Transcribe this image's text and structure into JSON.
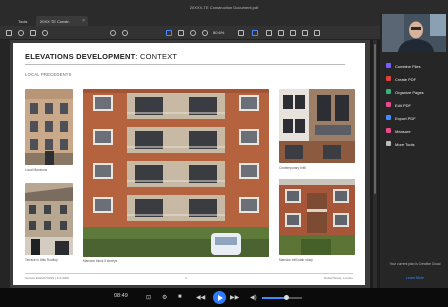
{
  "window": {
    "title": "20XXX-TE Construction Document.pdf"
  },
  "tabs": [
    {
      "label": "Tools"
    },
    {
      "label": "20XX TE Constr."
    }
  ],
  "toolbar": {
    "zoom": "80.6%"
  },
  "page": {
    "title_bold": "ELEVATIONS DEVELOPMENT",
    "title_rest": ": CONTEXT",
    "subtitle": "LOCAL PRECEDENTS",
    "captions": [
      "Local Mansions",
      "Terrace in Attic Rooftop",
      "Mansion block 5 storeys",
      "Contemporary Infill",
      "Mansion infill stair study"
    ],
    "footer": {
      "left": "Terrace ELEVATIONS  |  Job 0000",
      "center": "4",
      "right": "Dobell Street, London"
    }
  },
  "tools": [
    {
      "label": "Combine Files",
      "color": "#7b5cff"
    },
    {
      "label": "Create PDF",
      "color": "#e0413a"
    },
    {
      "label": "Organize Pages",
      "color": "#36b37e"
    },
    {
      "label": "Edit PDF",
      "color": "#e84a8a"
    },
    {
      "label": "Export PDF",
      "color": "#3d8bff"
    },
    {
      "label": "Measure",
      "color": "#e84a8a"
    },
    {
      "label": "More Tools",
      "color": "#bbbbbb"
    }
  ],
  "plan": {
    "text": "Your current plan is Creative Cloud",
    "link": "Learn More"
  },
  "player": {
    "time": "08:49",
    "volume": 0.6
  }
}
